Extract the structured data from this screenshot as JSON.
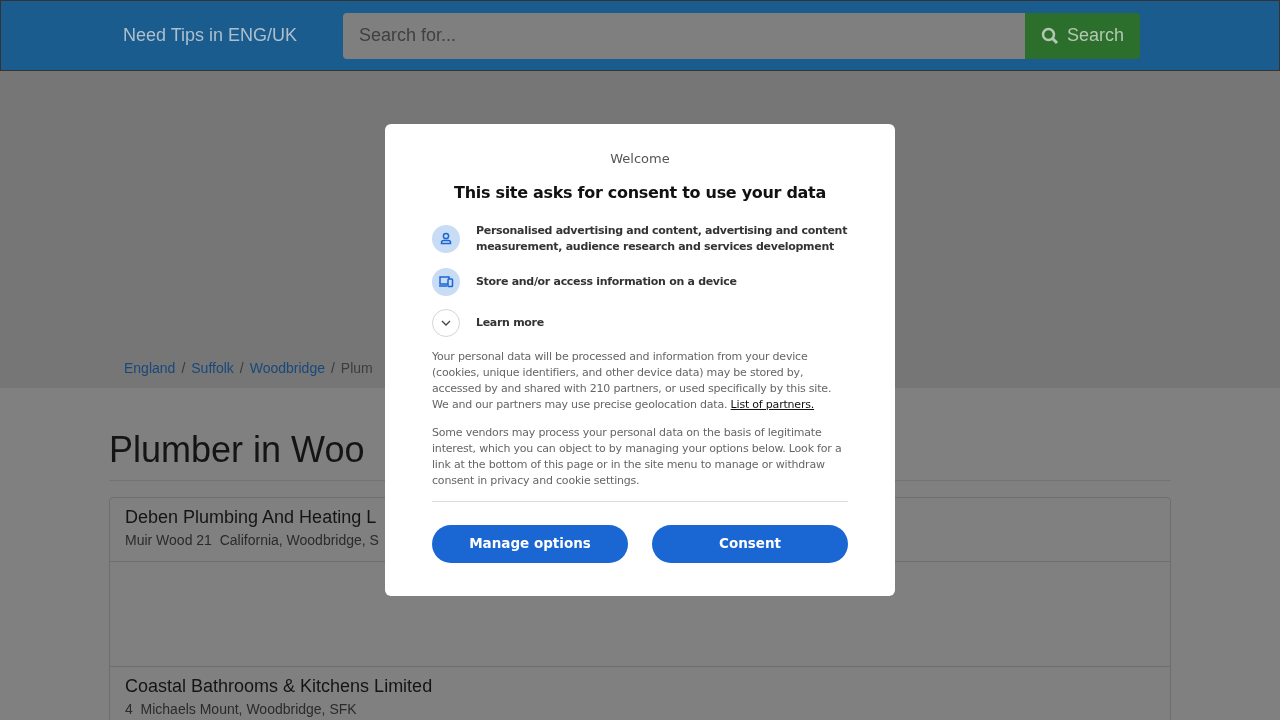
{
  "header": {
    "brand": "Need Tips in ENG/UK",
    "search": {
      "placeholder": "Search for...",
      "button": "Search"
    }
  },
  "breadcrumb": [
    {
      "label": "England",
      "link": true
    },
    {
      "separator": "/",
      "label": "Suffolk",
      "link": true
    },
    {
      "separator": "/",
      "label": "Woodbridge",
      "link": true
    },
    {
      "separator": "/",
      "label": "Plum",
      "link": false
    }
  ],
  "page_title": "Plumber in Woo",
  "listings": [
    {
      "name": "Deben Plumbing And Heating L",
      "address": "Muir Wood 21  California, Woodbridge, S"
    },
    {
      "name": "Coastal Bathrooms & Kitchens Limited",
      "address": "4  Michaels Mount, Woodbridge, SFK"
    }
  ],
  "consent_dialog": {
    "welcome": "Welcome",
    "title": "This site asks for consent to use your data",
    "purposes": [
      {
        "kind": "person",
        "text": "Personalised advertising and content, advertising and content measurement, audience research and services development"
      },
      {
        "kind": "device",
        "text": "Store and/or access information on a device"
      },
      {
        "kind": "expand",
        "text": "Learn more",
        "expanded": false
      }
    ],
    "paragraph_1": "Your personal data will be processed and information from your device (cookies, unique identifiers, and other device data) may be stored by, accessed by and shared with 210 partners, or used specifically by this site. We and our partners may use precise geolocation data.",
    "partners_link": "List of partners.",
    "paragraph_2": "Some vendors may process your personal data on the basis of legitimate interest, which you can object to by managing your options below. Look for a link at the bottom of this page or in the site menu to manage or withdraw consent in privacy and cookie settings.",
    "buttons": [
      "Manage options",
      "Consent"
    ]
  }
}
